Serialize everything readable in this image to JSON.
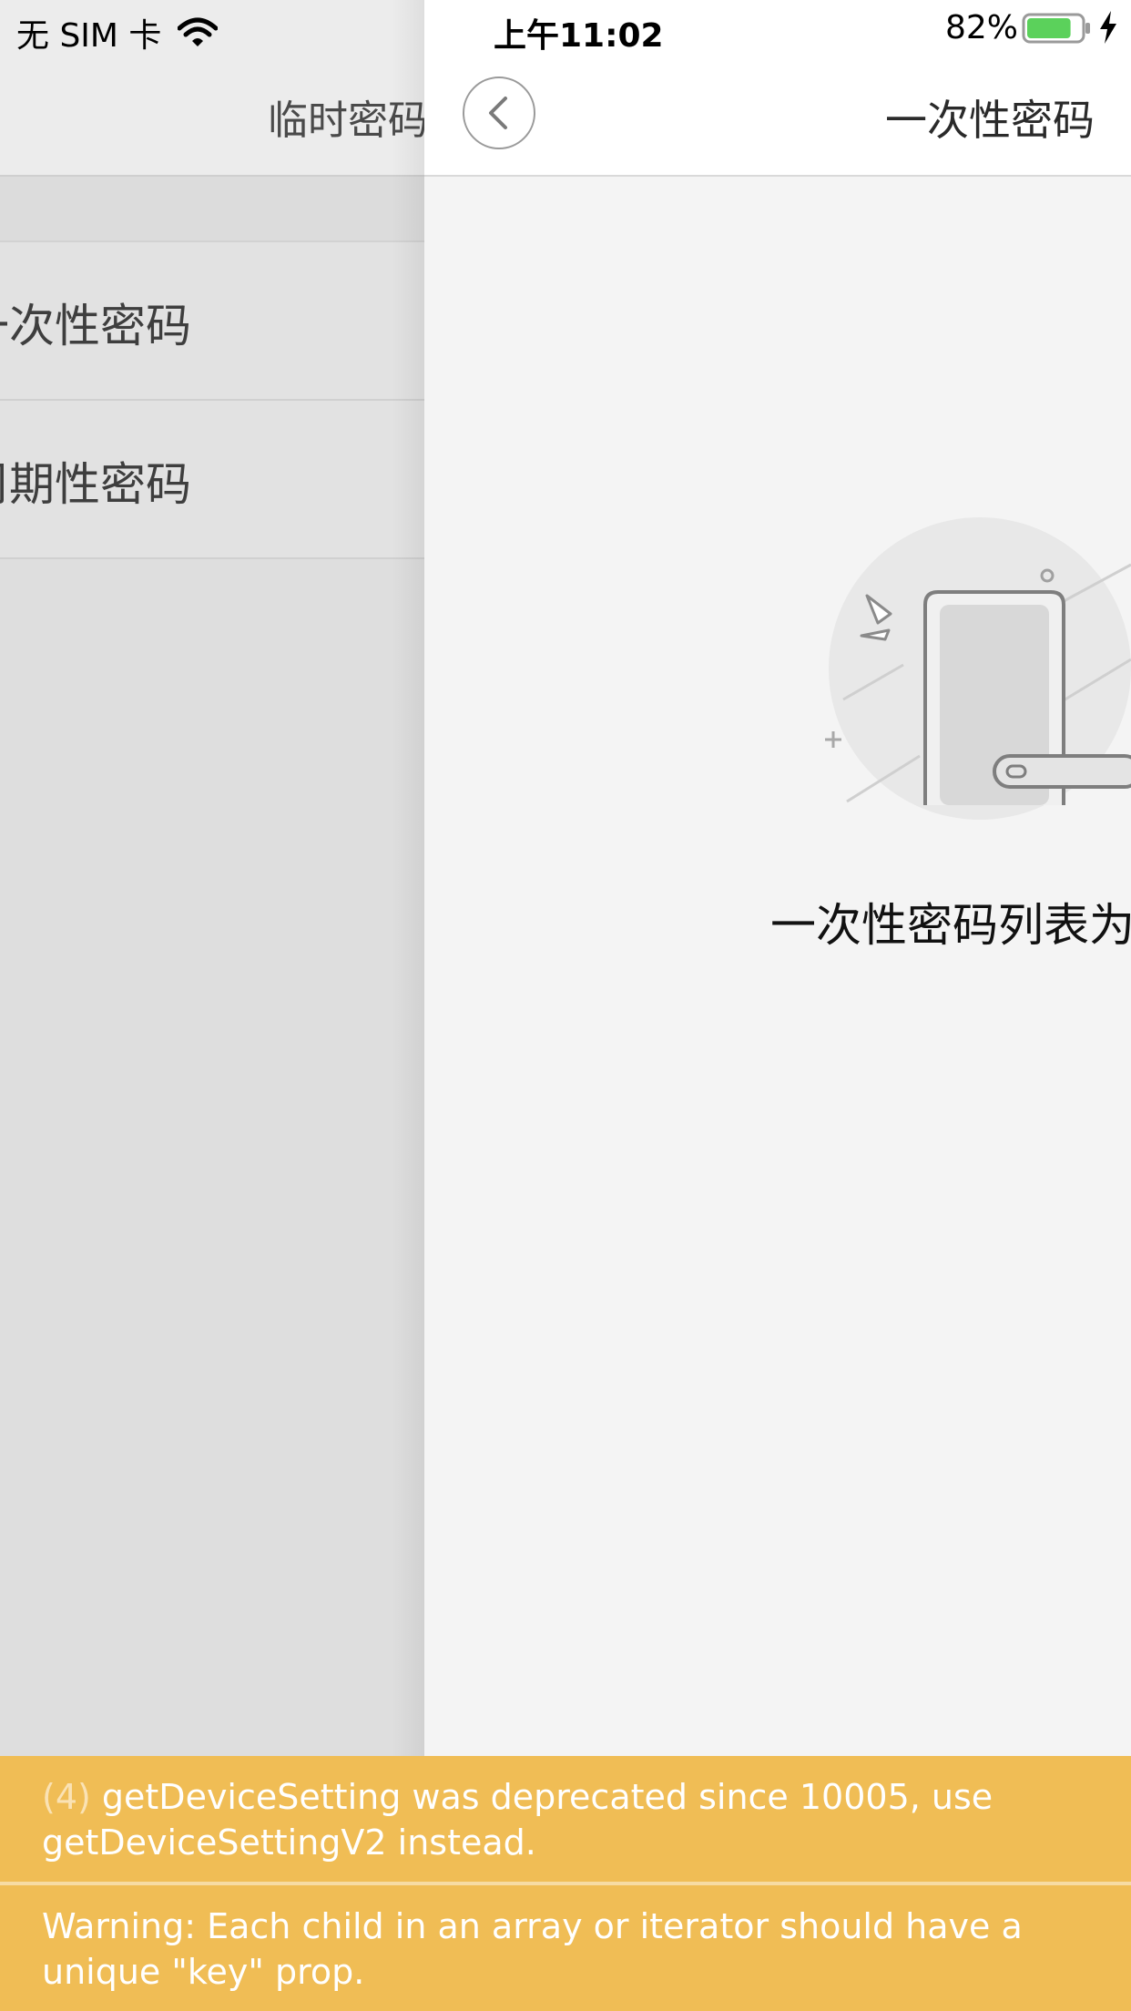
{
  "status_bar": {
    "carrier": "无 SIM 卡",
    "time": "上午11:02",
    "battery": "82%"
  },
  "background_page": {
    "title": "临时密码",
    "rows": [
      {
        "label": "一次性密码"
      },
      {
        "label": "周期性密码"
      }
    ]
  },
  "foreground_page": {
    "title": "一次性密码",
    "empty_text": "一次性密码列表为空"
  },
  "warnings": [
    {
      "count": "(4)",
      "message": " getDeviceSetting was deprecated since 10005, use getDeviceSettingV2 instead."
    },
    {
      "count": "",
      "message": "Warning: Each child in an array or iterator should have a unique \"key\" prop."
    }
  ],
  "colors": {
    "warning_bg": "#f0bd55",
    "battery_fill": "#5bd15b"
  }
}
